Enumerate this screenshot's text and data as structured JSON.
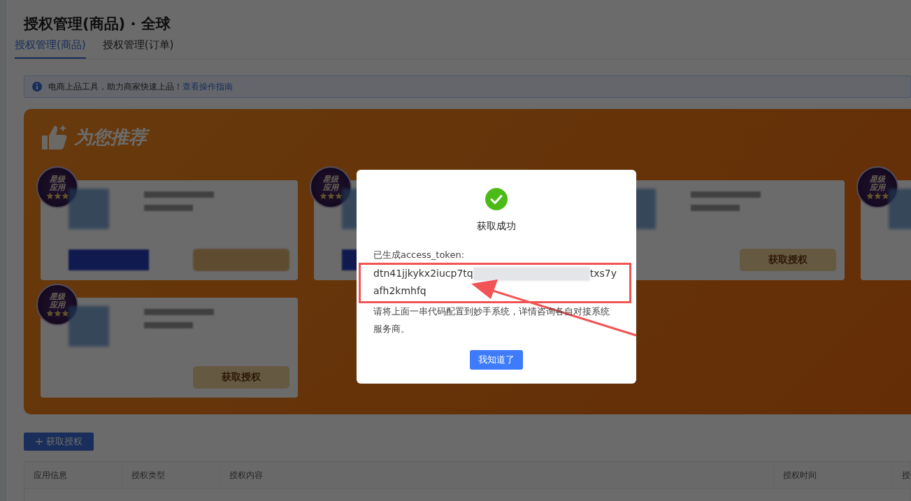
{
  "page": {
    "title": "授权管理(商品) · 全球"
  },
  "tabs": [
    {
      "label": "授权管理(商品)",
      "selected": true
    },
    {
      "label": "授权管理(订单)",
      "selected": false
    }
  ],
  "notice": {
    "text": "电商上品工具，助力商家快速上品！",
    "link": "查看操作指南"
  },
  "recommend": {
    "title": "为您推荐",
    "cards": [
      {
        "badge": "星级应用",
        "stars": 3,
        "kind": "blurred"
      },
      {
        "badge": "星级应用",
        "stars": 3,
        "kind": "blurred"
      },
      {
        "kind": "button",
        "button": "获取授权"
      },
      {
        "badge": "星级应用",
        "stars": 3,
        "kind": "plain"
      },
      {
        "badge": "星级应用",
        "stars": 3,
        "kind": "button",
        "button": "获取授权"
      }
    ]
  },
  "add_button": "获取授权",
  "table": {
    "columns": [
      "应用信息",
      "授权类型",
      "授权内容",
      "授权时间",
      "授"
    ]
  },
  "dialog": {
    "title": "获取成功",
    "label": "已生成access_token:",
    "token_start": "dtn41jjkykx2iucp7tq",
    "token_end": "txs7y",
    "token_line2": "afh2kmhfq",
    "hint": "请将上面一串代码配置到妙手系统，详情咨询各自对接系统服务商。",
    "button": "我知道了"
  }
}
